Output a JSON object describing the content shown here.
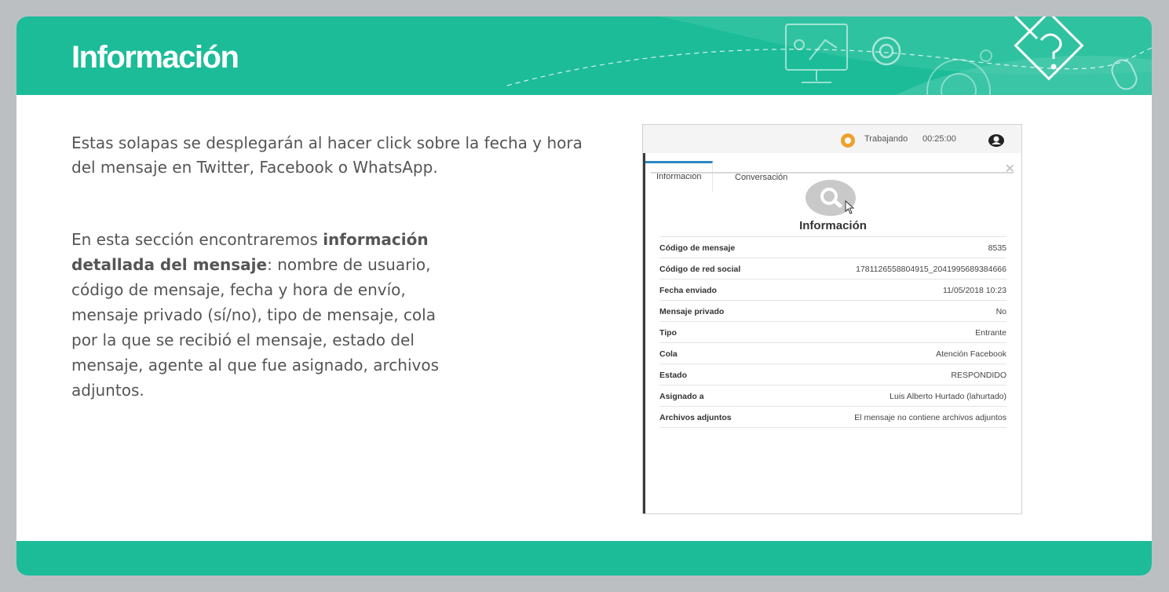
{
  "header": {
    "title": "Información"
  },
  "body": {
    "paragraph1": "Estas solapas se desplegarán al hacer click sobre la  fecha y hora del mensaje en Twitter, Facebook o WhatsApp.",
    "paragraph2_intro": "En esta sección encontraremos ",
    "paragraph2_bold": "información detallada del mensaje",
    "paragraph2_rest": ": nombre de usuario, código de mensaje, fecha y hora de envío, mensaje privado (sí/no), tipo de mensaje, cola por la que se recibió el mensaje, estado del mensaje, agente al que fue asignado, archivos adjuntos."
  },
  "screenshot": {
    "status": "Trabajando",
    "timer": "00:25:00",
    "tabs": [
      "Información",
      "Conversación"
    ],
    "close": "✕",
    "section_title": "Información",
    "rows": [
      {
        "label": "Código de mensaje",
        "value": "8535"
      },
      {
        "label": "Código de red social",
        "value": "1781126558804915_2041995689384666"
      },
      {
        "label": "Fecha enviado",
        "value": "11/05/2018 10:23"
      },
      {
        "label": "Mensaje privado",
        "value": "No"
      },
      {
        "label": "Tipo",
        "value": "Entrante"
      },
      {
        "label": "Cola",
        "value": "Atención Facebook"
      },
      {
        "label": "Estado",
        "value": "RESPONDIDO"
      },
      {
        "label": "Asignado a",
        "value": "Luis Alberto Hurtado (lahurtado)"
      },
      {
        "label": "Archivos adjuntos",
        "value": "El mensaje no contiene archivos adjuntos"
      }
    ]
  },
  "colors": {
    "brand": "#1cbc99",
    "background": "#bcbfc2",
    "tab_accent": "#2e86c1"
  },
  "icons": [
    "monitor-presentation-icon",
    "gear-icon",
    "settings-wheel-icon",
    "pencil-question-icon",
    "mouse-icon",
    "status-icon",
    "user-icon",
    "search-icon",
    "cursor-icon"
  ]
}
